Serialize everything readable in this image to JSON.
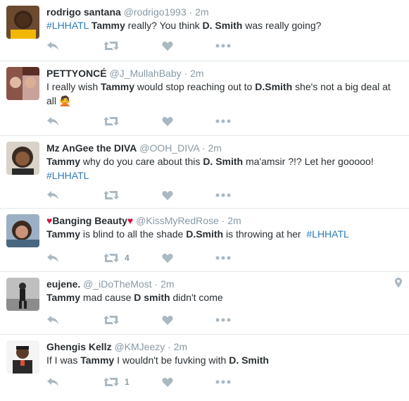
{
  "tweets": [
    {
      "name": "rodrigo santana",
      "handle": "@rodrigo1993",
      "time": "2m",
      "text_parts": [
        "#LHHATL",
        " ",
        "Tammy",
        " really? You think ",
        "D. Smith",
        " was really going?"
      ],
      "retweets": "",
      "likes": ""
    },
    {
      "name": "PETTYONCÉ",
      "handle": "@J_MullahBaby",
      "time": "2m",
      "text_parts": [
        "I really wish ",
        "Tammy",
        " would stop reaching out to ",
        "D.Smith",
        " she's not a big deal at all",
        "🙅"
      ],
      "retweets": "",
      "likes": ""
    },
    {
      "name": "Mz AnGee the DIVA",
      "handle": "@OOH_DIVA",
      "time": "2m",
      "text_parts": [
        "Tammy",
        " why do you care about this ",
        "D. Smith",
        " ma'amsir ?!? Let her gooooo!",
        "#LHHATL"
      ],
      "retweets": "",
      "likes": ""
    },
    {
      "name_heart_left": "♥",
      "name": "Banging Beauty",
      "name_heart_right": "♥",
      "handle": "@KissMyRedRose",
      "time": "2m",
      "text_parts": [
        "Tammy",
        " is blind to all the shade ",
        "D.Smith",
        " is throwing at her  ",
        "#LHHATL"
      ],
      "retweets": "4",
      "likes": ""
    },
    {
      "name": "eujene.",
      "handle": "@_iDoTheMost",
      "time": "2m",
      "text_parts": [
        "Tammy",
        " mad cause ",
        "D smith",
        " didn't come"
      ],
      "retweets": "",
      "likes": ""
    },
    {
      "name": "Ghengis Kellz",
      "handle": "@KMJeezy",
      "time": "2m",
      "text_parts": [
        "If I was ",
        "Tammy",
        " I wouldn't be fuvking with ",
        "D. Smith"
      ],
      "retweets": "1",
      "likes": ""
    }
  ],
  "colors": {
    "link": "#2b7bb9",
    "meta": "#8899a6",
    "icon": "#aab8c2",
    "divider": "#e1e8ed",
    "heart_red": "#d3143f"
  }
}
